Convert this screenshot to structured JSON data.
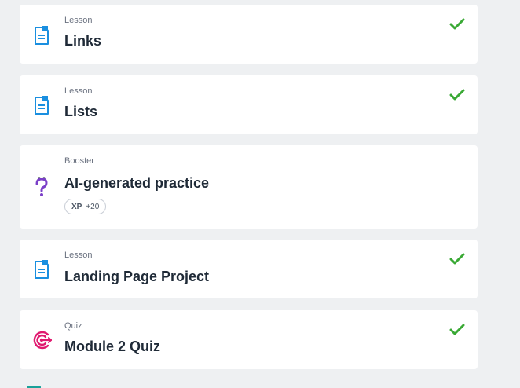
{
  "items": [
    {
      "kind": "Lesson",
      "title": "Links",
      "icon": "lesson-document-icon",
      "completed": true
    },
    {
      "kind": "Lesson",
      "title": "Lists",
      "icon": "lesson-document-icon",
      "completed": true
    },
    {
      "kind": "Booster",
      "title": "AI-generated practice",
      "icon": "booster-question-icon",
      "completed": false,
      "xp": {
        "label": "XP",
        "value": "+20"
      }
    },
    {
      "kind": "Lesson",
      "title": "Landing Page Project",
      "icon": "lesson-document-icon",
      "completed": true
    },
    {
      "kind": "Quiz",
      "title": "Module 2 Quiz",
      "icon": "quiz-target-icon",
      "completed": true
    }
  ],
  "colors": {
    "lesson_icon": "#1a8fe0",
    "booster_icon": "#7b3fc8",
    "quiz_icon": "#e0196f",
    "check": "#3aa935",
    "background": "#eef0f2"
  }
}
